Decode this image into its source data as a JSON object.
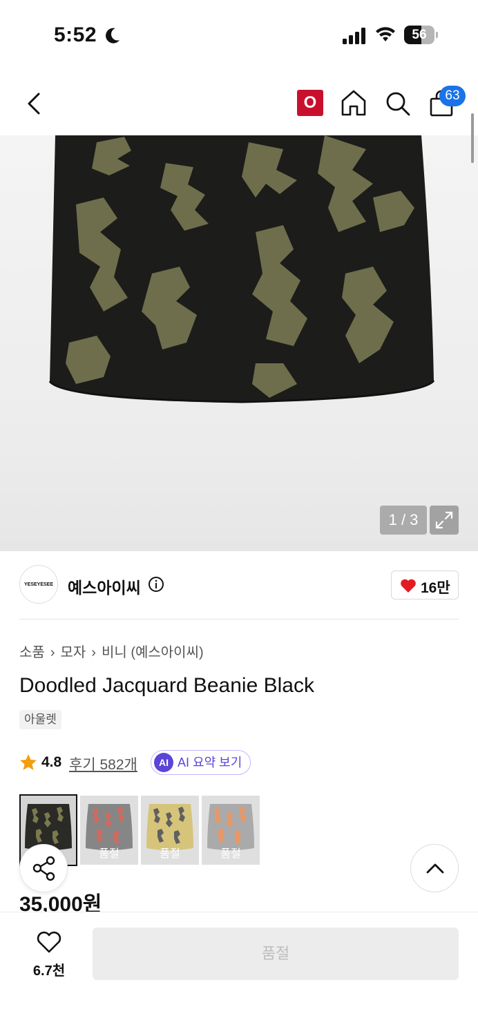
{
  "status_bar": {
    "time": "5:52",
    "battery_level": "56",
    "battery_fraction": 0.56
  },
  "nav": {
    "o_badge": "O",
    "cart_count": "63"
  },
  "hero": {
    "image_counter": "1 / 3"
  },
  "brand": {
    "logo_text": "YESEYESEE",
    "name": "예스아이씨",
    "like_count": "16만"
  },
  "breadcrumb": [
    "소품",
    "모자",
    "비니 (예스아이씨)"
  ],
  "product": {
    "title": "Doodled Jacquard Beanie Black",
    "tag": "아울렛",
    "rating": "4.8",
    "reviews": "후기 582개",
    "ai_badge": "AI",
    "ai_label": "AI 요약 보기",
    "price": "35,000원"
  },
  "thumbnails": [
    {
      "color": "#2a2a26",
      "pattern": "#7a7a4e",
      "status": ""
    },
    {
      "color": "#5e5e5e",
      "pattern": "#c0392b",
      "status": "품절"
    },
    {
      "color": "#c7b04e",
      "pattern": "#2b2b2b",
      "status": "품절"
    },
    {
      "color": "#8e8e8e",
      "pattern": "#e8732c",
      "status": "품절"
    }
  ],
  "bottom": {
    "wish_count": "6.7천",
    "buy_label": "품절"
  },
  "colors": {
    "accent_blue": "#1a73e8",
    "brand_red": "#c8102e",
    "ai_purple": "#5b45d6",
    "star": "#f59d0c"
  }
}
